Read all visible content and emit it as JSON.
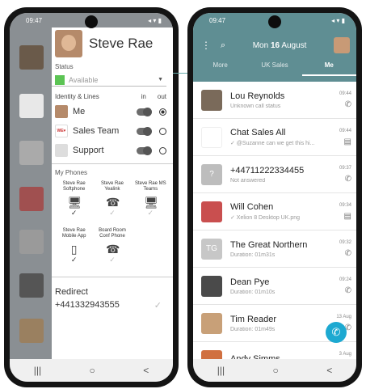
{
  "left": {
    "time": "09:47",
    "status_icons": "◂ ▾ ▮",
    "profile_name": "Steve Rae",
    "status_label": "Status",
    "status_value": "Available",
    "lines_header": "Identity & Lines",
    "col_in": "in",
    "col_out": "out",
    "lines": [
      {
        "label": "Me",
        "icon_color": "#b58a6a"
      },
      {
        "label": "Sales Team",
        "icon_color": "#ffffff"
      },
      {
        "label": "Support",
        "icon_color": "#dddddd"
      }
    ],
    "phones_header": "My Phones",
    "phones": [
      {
        "name": "Steve Rae Softphone",
        "icon": "desktop-icon",
        "glyph": "🖥",
        "check": "✓",
        "dim": false
      },
      {
        "name": "Steve Rae Yealink",
        "icon": "desk-phone-icon",
        "glyph": "☎",
        "check": "✓",
        "dim": true
      },
      {
        "name": "Steve Rae MS Teams",
        "icon": "desktop-icon",
        "glyph": "🖥",
        "check": "✓",
        "dim": true
      },
      {
        "name": "Steve Rae Mobile App",
        "icon": "mobile-icon",
        "glyph": "▯",
        "check": "✓",
        "dim": false
      },
      {
        "name": "Board Room Conf Phone",
        "icon": "desk-phone-icon",
        "glyph": "☎",
        "check": "✓",
        "dim": true
      }
    ],
    "redirect_label": "Redirect",
    "redirect_number": "+441332943555",
    "redirect_check": "✓"
  },
  "right": {
    "time": "09:47",
    "date_prefix": "Mon",
    "date_day": "16",
    "date_month": "August",
    "tabs": [
      "More",
      "UK Sales",
      "Me"
    ],
    "rows": [
      {
        "name": "Lou Reynolds",
        "sub": "Unknown call status",
        "time": "09:44",
        "icon": "phone-icon",
        "glyph": "✆",
        "av_color": "#7a6a5a",
        "av_text": ""
      },
      {
        "name": "Chat Sales All",
        "sub": "✓ @Suzanne can we get this hi...",
        "time": "09:44",
        "icon": "chat-icon",
        "glyph": "▤",
        "av_color": "#ffffff",
        "av_text": ""
      },
      {
        "name": "+44711222334455",
        "sub": "Not answered",
        "time": "09:37",
        "icon": "phone-icon",
        "glyph": "✆",
        "av_color": "#bdbdbd",
        "av_text": "?"
      },
      {
        "name": "Will Cohen",
        "sub": "✓ Xelion 8 Desktop UK.png",
        "time": "09:34",
        "icon": "chat-icon",
        "glyph": "▤",
        "av_color": "#c94f4f",
        "av_text": ""
      },
      {
        "name": "The Great Northern",
        "sub": "Duration: 01m31s",
        "time": "09:32",
        "icon": "phone-icon",
        "glyph": "✆",
        "av_color": "#c7c7c7",
        "av_text": "TG"
      },
      {
        "name": "Dean Pye",
        "sub": "Duration: 01m10s",
        "time": "09:24",
        "icon": "phone-icon",
        "glyph": "✆",
        "av_color": "#4a4a4a",
        "av_text": ""
      },
      {
        "name": "Tim Reader",
        "sub": "Duration: 01m49s",
        "time": "13 Aug",
        "icon": "phone-icon",
        "glyph": "✆",
        "av_color": "#c8a078",
        "av_text": ""
      },
      {
        "name": "Andy Simms",
        "sub": "",
        "time": "3 Aug",
        "icon": "phone-icon",
        "glyph": "✆",
        "av_color": "#d07040",
        "av_text": ""
      }
    ],
    "fab_glyph": "✆"
  },
  "nav": {
    "recent": "|||",
    "home": "○",
    "back": "<"
  },
  "colors": {
    "teal": "#5f8e93",
    "fab": "#1da9d1",
    "available": "#5cc454"
  }
}
